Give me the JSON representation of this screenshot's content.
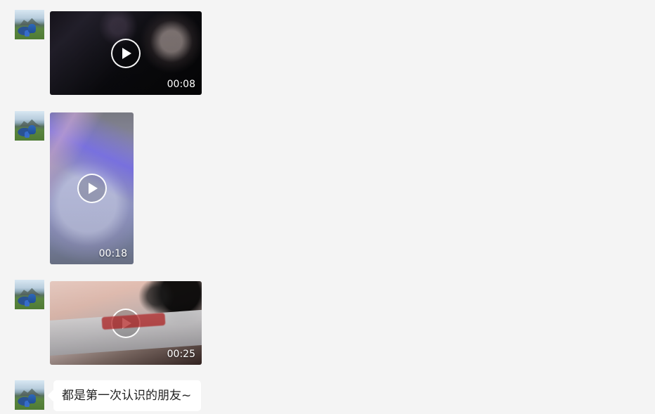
{
  "chat": {
    "messages": [
      {
        "type": "video",
        "duration": "00:08"
      },
      {
        "type": "video",
        "duration": "00:18"
      },
      {
        "type": "video",
        "duration": "00:25"
      },
      {
        "type": "text",
        "text": "都是第一次认识的朋友~"
      }
    ]
  },
  "icons": {
    "play": "play-icon"
  }
}
